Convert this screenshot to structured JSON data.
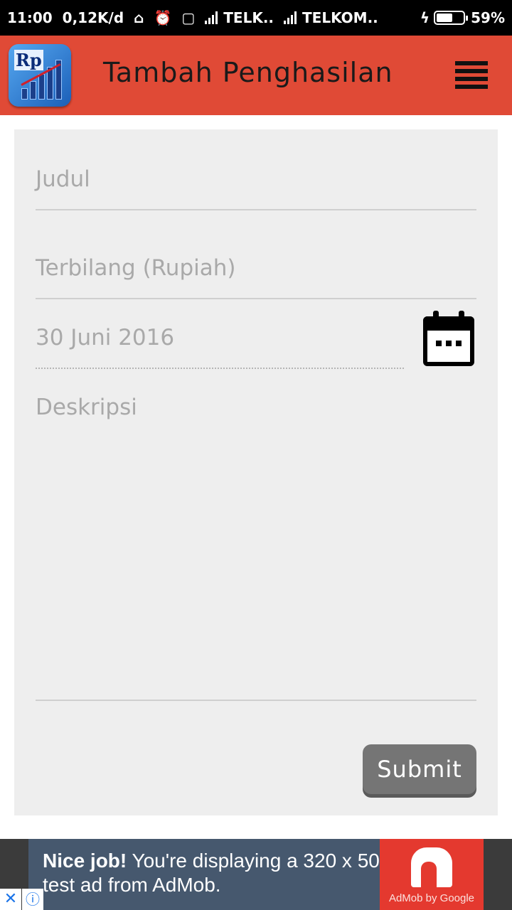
{
  "status_bar": {
    "time": "11:00",
    "net_speed": "0,12K/d",
    "carrier1": "TELK..",
    "carrier2": "TELKOM..",
    "battery": "59%"
  },
  "app_bar": {
    "title": "Tambah Penghasilan",
    "logo_text": "Rp"
  },
  "form": {
    "judul_placeholder": "Judul",
    "terbilang_placeholder": "Terbilang (Rupiah)",
    "tanggal_value": "30 Juni 2016",
    "deskripsi_placeholder": "Deskripsi",
    "submit_label": "Submit"
  },
  "ad": {
    "headline": "Nice job!",
    "body": " You're displaying a 320 x 50 test ad from AdMob.",
    "brand": "AdMob by Google",
    "close_symbol": "✕",
    "info_symbol": "ⓘ"
  },
  "colors": {
    "app_bar": "#e04a36",
    "form_background": "#eeeeee",
    "submit_button": "#757575",
    "ad_background": "#46586e",
    "ad_logo_background": "#e4392f"
  },
  "icons": {
    "menu": "hamburger-menu-icon",
    "calendar": "calendar-icon",
    "logo": "app-logo"
  }
}
